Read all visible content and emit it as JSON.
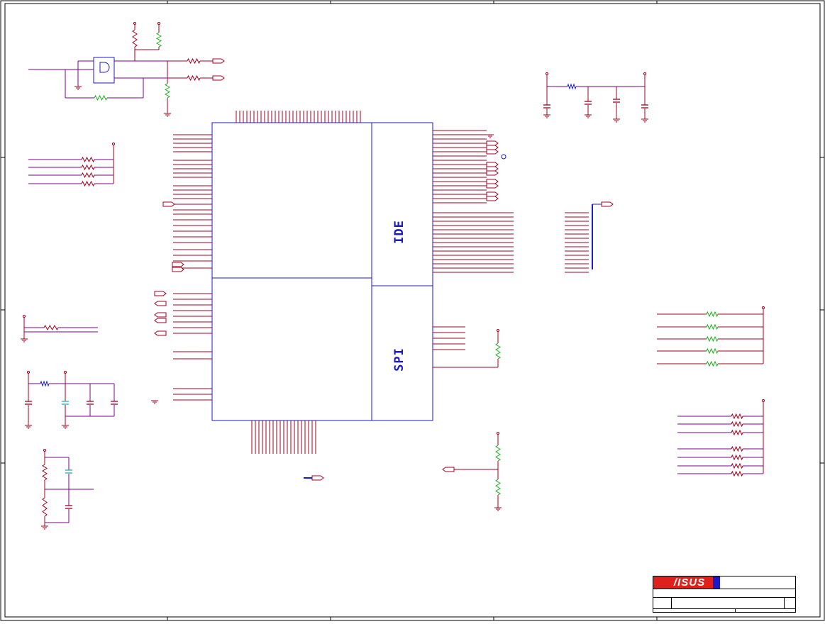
{
  "blocks": {
    "ide_label": "IDE",
    "spi_label": "SPI"
  },
  "title_block": {
    "logo_text": "/ISUS",
    "registered_mark": "®"
  },
  "colors": {
    "wire": "#a0001e",
    "net": "#7a008a",
    "outline": "#1a1ac8",
    "resistor": "#a0001e",
    "ferrite": "#20b020",
    "logo_red": "#e0201a",
    "logo_blue": "#1a1ac8"
  },
  "icons": [
    "ground-icon",
    "power-flag-icon",
    "resistor-icon",
    "capacitor-icon",
    "net-port-icon",
    "and-gate-icon"
  ]
}
